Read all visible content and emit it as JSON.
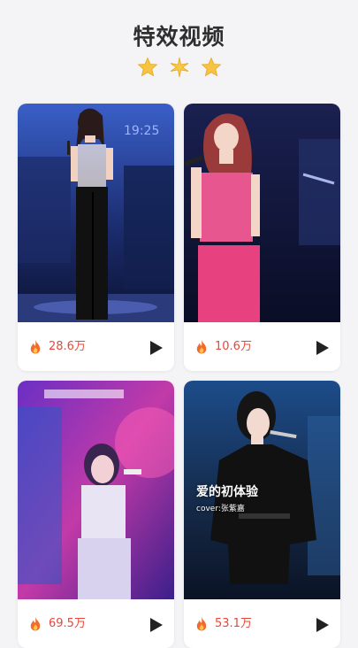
{
  "page": {
    "title": "特效视频",
    "star_colors": [
      "#f6c342",
      "#f7c948",
      "#f6c342"
    ]
  },
  "cards": [
    {
      "count": "28.6万",
      "overlay_text": "",
      "theme": "blue-stage"
    },
    {
      "count": "10.6万",
      "overlay_text": "",
      "theme": "pink-outfit"
    },
    {
      "count": "69.5万",
      "overlay_text": "",
      "theme": "purple-neon"
    },
    {
      "count": "53.1万",
      "overlay_text": "爱的初体验",
      "overlay_sub": "cover:张紫嘉",
      "theme": "dark-stage"
    }
  ],
  "icons": {
    "fire": "fire-icon",
    "play": "play-icon",
    "star": "star-icon"
  }
}
